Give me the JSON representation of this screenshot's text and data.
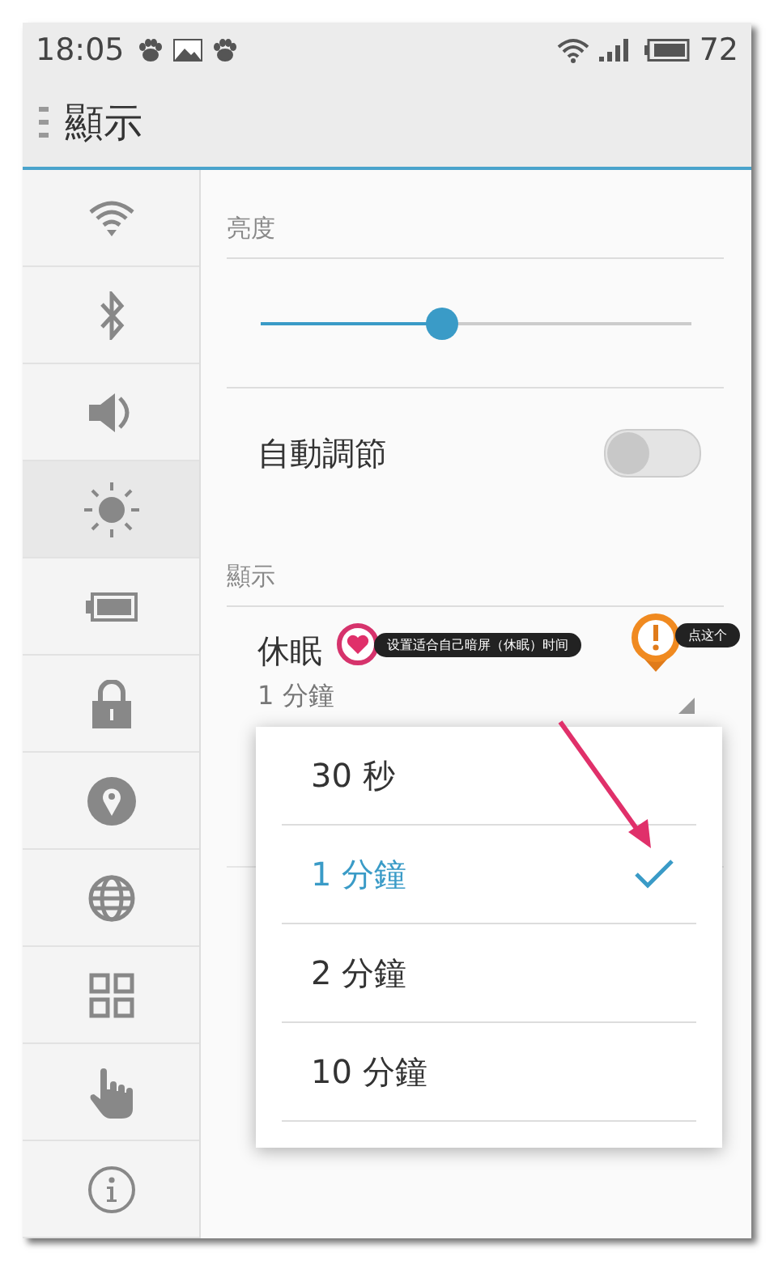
{
  "status_bar": {
    "time": "18:05",
    "battery": "72"
  },
  "app_bar": {
    "title": "顯示"
  },
  "sidebar": {
    "items": [
      {
        "kind": "wifi",
        "selected": false
      },
      {
        "kind": "bluetooth",
        "selected": false
      },
      {
        "kind": "sound",
        "selected": false
      },
      {
        "kind": "brightness",
        "selected": true
      },
      {
        "kind": "battery",
        "selected": false
      },
      {
        "kind": "lock",
        "selected": false
      },
      {
        "kind": "location",
        "selected": false
      },
      {
        "kind": "globe",
        "selected": false
      },
      {
        "kind": "apps",
        "selected": false
      },
      {
        "kind": "gesture",
        "selected": false
      },
      {
        "kind": "info",
        "selected": false
      }
    ]
  },
  "brightness": {
    "header": "亮度",
    "level": 0.42
  },
  "auto_adjust": {
    "label": "自動調節",
    "on": false
  },
  "display_section": {
    "header": "顯示"
  },
  "sleep": {
    "label": "休眠",
    "value": "1 分鐘"
  },
  "dropdown": {
    "options": [
      {
        "label": "30 秒",
        "selected": false
      },
      {
        "label": "1 分鐘",
        "selected": true
      },
      {
        "label": "2 分鐘",
        "selected": false
      },
      {
        "label": "10 分鐘",
        "selected": false
      }
    ]
  },
  "annotations": [
    {
      "kind": "heart",
      "text": "设置适合自己暗屏（休眠）时间"
    },
    {
      "kind": "alert",
      "text": "点这个"
    }
  ]
}
